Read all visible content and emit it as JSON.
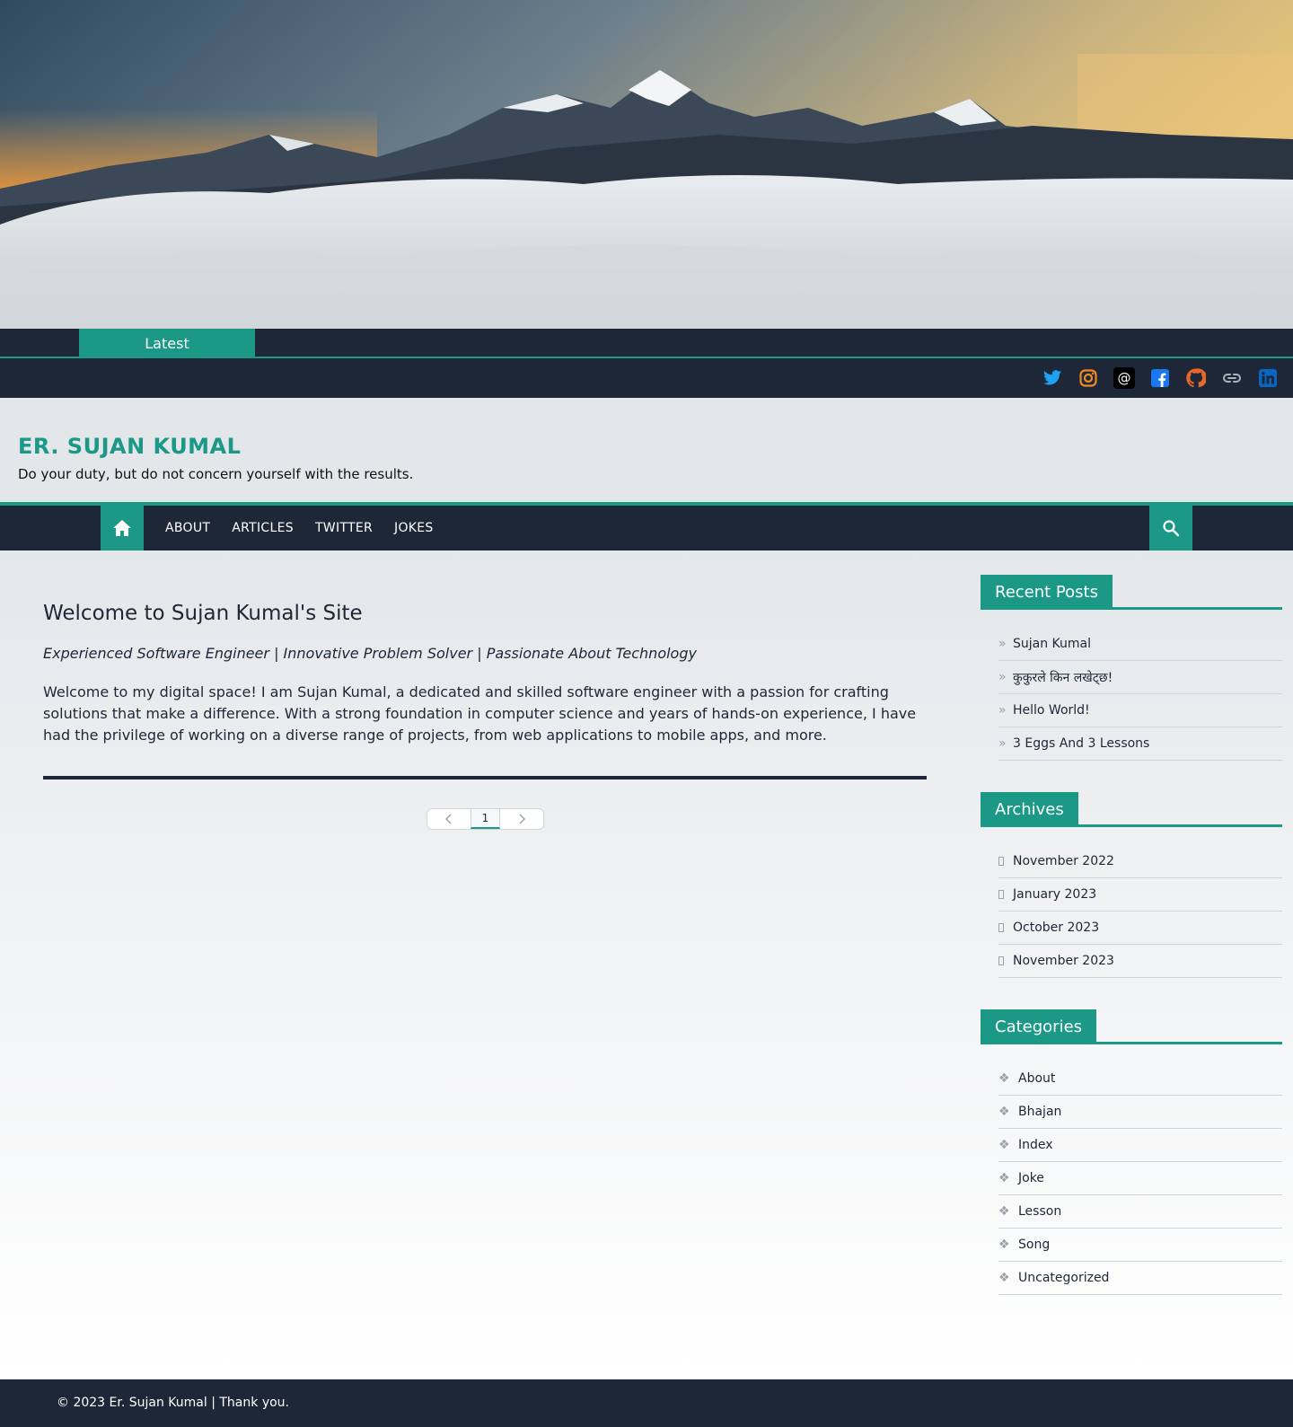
{
  "ticker": {
    "label": "Latest"
  },
  "social": {
    "icons": [
      "twitter-icon",
      "instagram-icon",
      "threads-icon",
      "facebook-icon",
      "github-icon",
      "link-icon",
      "linkedin-icon"
    ]
  },
  "site": {
    "title": "ER. SUJAN KUMAL",
    "tagline": "Do your duty, but do not concern yourself with the results."
  },
  "nav": {
    "items": [
      "ABOUT",
      "ARTICLES",
      "TWITTER",
      "JOKES"
    ]
  },
  "post": {
    "title": "Welcome to Sujan Kumal's Site",
    "subtitle": "Experienced Software Engineer | Innovative Problem Solver | Passionate About Technology",
    "body": "Welcome to my digital space! I am Sujan Kumal, a dedicated and skilled software engineer with a passion for crafting solutions that make a difference. With a strong foundation in computer science and years of hands-on experience, I have had the privilege of working on a diverse range of projects, from web applications to mobile apps, and more."
  },
  "pagination": {
    "current": "1"
  },
  "sidebar": {
    "recent": {
      "title": "Recent Posts",
      "items": [
        "Sujan Kumal",
        "कुकुरले किन लखेट्छ!",
        "Hello World!",
        "3 Eggs And 3 Lessons"
      ]
    },
    "archives": {
      "title": "Archives",
      "items": [
        "November 2022",
        "January 2023",
        "October 2023",
        "November 2023"
      ]
    },
    "categories": {
      "title": "Categories",
      "items": [
        "About",
        "Bhajan",
        "Index",
        "Joke",
        "Lesson",
        "Song",
        "Uncategorized"
      ]
    }
  },
  "footer": {
    "text": "© 2023 Er. Sujan Kumal | Thank you."
  },
  "colors": {
    "accent": "#1b9886",
    "dark": "#1d2737"
  }
}
